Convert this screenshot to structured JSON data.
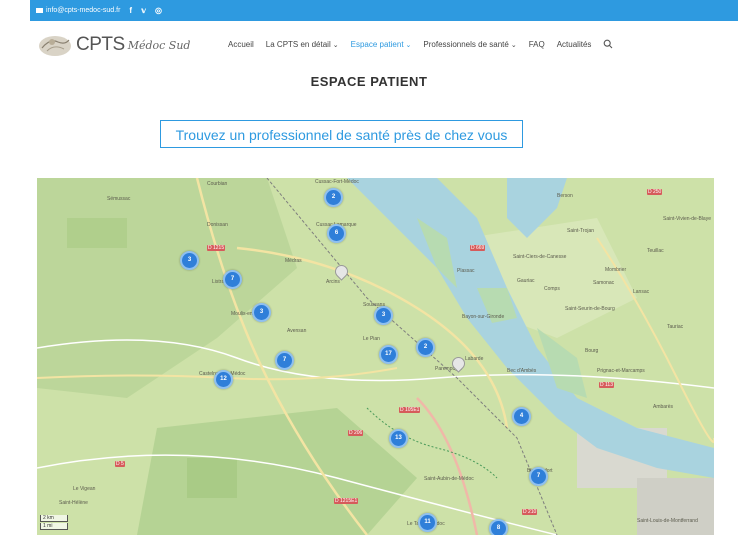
{
  "topbar": {
    "email": "info@cpts-medoc-sud.fr",
    "social": [
      "f",
      "𝕧",
      "◎"
    ]
  },
  "logo": {
    "text": "CPTS",
    "script": "Médoc Sud"
  },
  "nav": {
    "items": [
      {
        "label": "Accueil",
        "dropdown": false,
        "active": false
      },
      {
        "label": "La CPTS en détail",
        "dropdown": true,
        "active": false
      },
      {
        "label": "Espace patient",
        "dropdown": true,
        "active": true
      },
      {
        "label": "Professionnels de santé",
        "dropdown": true,
        "active": false
      },
      {
        "label": "FAQ",
        "dropdown": false,
        "active": false
      },
      {
        "label": "Actualités",
        "dropdown": false,
        "active": false
      }
    ],
    "search_icon": "search-icon"
  },
  "page": {
    "title": "ESPACE PATIENT",
    "cta_label": "Trouvez un professionnel de santé près de chez vous"
  },
  "map": {
    "clusters": [
      "2",
      "6",
      "3",
      "7",
      "3",
      "3",
      "2",
      "17",
      "7",
      "12",
      "13",
      "4",
      "7",
      "11",
      "8"
    ],
    "place_labels": [
      "Sémussac",
      "Courbian",
      "Cussac-Fort-Médoc",
      "Donissan",
      "Cussac Lamarque",
      "Médras",
      "Listrac",
      "Moulis-en-Médoc",
      "Arcins",
      "Soussans",
      "Labarde",
      "Castelnau-de-Médoc",
      "Le Pian",
      "Parempuyre",
      "Saint-Ciers-de-Canesse",
      "Gauriac",
      "Plassac",
      "Samonac",
      "Mombrier",
      "Lansac",
      "Saint-Seurin-de-Bourg",
      "Bourg",
      "Ambarès",
      "Saint-Hélène",
      "Saint-Aubin-de-Médoc",
      "Blanquefort",
      "Le Taillan-Médoc",
      "Saint-Louis-de-Montferrand",
      "Berson",
      "Saint-Vivien-de-Blaye",
      "Teuillac",
      "Comps",
      "Bayon-sur-Gironde",
      "Tauriac",
      "Prignac-et-Marcamps",
      "Bec d'Ambès",
      "Saint-Trojan",
      "Le Vigean",
      "Avensan"
    ],
    "road_labels": [
      "D 1215",
      "D 669",
      "D 113",
      "D 105E1",
      "D 206",
      "D 5",
      "D 1215E1",
      "D 210",
      "D 250"
    ],
    "scale": [
      "2 km",
      "1 mi"
    ]
  }
}
